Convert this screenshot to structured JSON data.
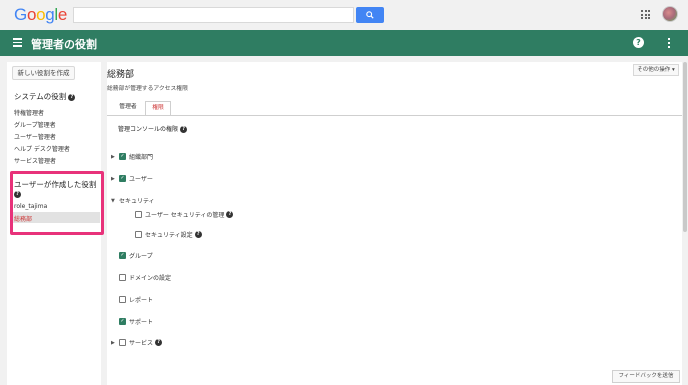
{
  "brand": {
    "logo_letters": [
      "G",
      "o",
      "o",
      "g",
      "l",
      "e"
    ],
    "logo_colors": [
      "#4285f4",
      "#ea4335",
      "#fbbc05",
      "#4285f4",
      "#34a853",
      "#ea4335"
    ]
  },
  "appbar": {
    "title": "管理者の役割",
    "color": "#2f7d62"
  },
  "sidebar": {
    "new_role_button": "新しい役割を作成",
    "system_roles_heading": "システムの役割",
    "system_roles": [
      "特権管理者",
      "グループ管理者",
      "ユーザー管理者",
      "ヘルプ デスク管理者",
      "サービス管理者"
    ],
    "user_roles_heading": "ユーザーが作成した役割",
    "user_roles": [
      "role_tajima",
      "総務部"
    ],
    "selected_role": "総務部"
  },
  "main": {
    "other_ops_button": "その他の操作",
    "role_title": "総務部",
    "role_subtitle": "総務部が管理するアクセス権限",
    "tabs": [
      "管理者",
      "権限"
    ],
    "active_tab": "権限",
    "section_heading": "管理コンソールの権限",
    "permissions": [
      {
        "label": "組織部門",
        "checked": true,
        "expandable": true
      },
      {
        "label": "ユーザー",
        "checked": true,
        "expandable": true
      },
      {
        "label": "セキュリティ",
        "checked": false,
        "expandable": true,
        "expanded": true
      },
      {
        "label": "ユーザー セキュリティの管理",
        "checked": false,
        "sub": true
      },
      {
        "label": "セキュリティ設定",
        "checked": false,
        "sub": true
      },
      {
        "label": "グループ",
        "checked": true
      },
      {
        "label": "ドメインの設定",
        "checked": false
      },
      {
        "label": "レポート",
        "checked": false
      },
      {
        "label": "サポート",
        "checked": true
      },
      {
        "label": "サービス",
        "checked": false,
        "expandable": true
      }
    ]
  },
  "feedback_button": "フィードバックを送信"
}
